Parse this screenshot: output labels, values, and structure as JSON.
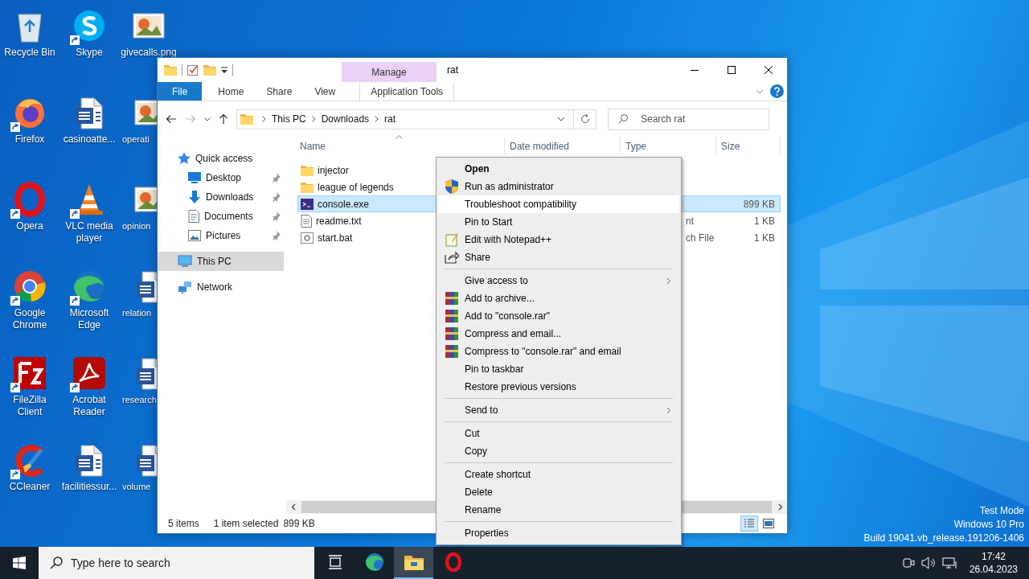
{
  "desktop": {
    "columns": [
      [
        {
          "label": "Recycle Bin",
          "kind": "recycle",
          "shortcut": false
        },
        {
          "label": "Firefox",
          "kind": "firefox",
          "shortcut": true
        },
        {
          "label": "Opera",
          "kind": "opera",
          "shortcut": true
        },
        {
          "label": "Google Chrome",
          "kind": "chrome",
          "shortcut": true
        },
        {
          "label": "FileZilla Client",
          "kind": "filezilla",
          "shortcut": true
        },
        {
          "label": "CCleaner",
          "kind": "ccleaner",
          "shortcut": true
        }
      ],
      [
        {
          "label": "Skype",
          "kind": "skype",
          "shortcut": true
        },
        {
          "label": "casinoatte...",
          "kind": "word",
          "shortcut": false
        },
        {
          "label": "VLC media player",
          "kind": "vlc",
          "shortcut": true
        },
        {
          "label": "Microsoft Edge",
          "kind": "edge",
          "shortcut": true
        },
        {
          "label": "Acrobat Reader",
          "kind": "acrobat",
          "shortcut": true
        },
        {
          "label": "facilitiessur...",
          "kind": "word",
          "shortcut": false
        }
      ],
      [
        {
          "label": "givecalls.png",
          "kind": "image",
          "shortcut": false
        },
        {
          "label": "operati",
          "kind": "image",
          "shortcut": false
        },
        {
          "label": "opinion",
          "kind": "image",
          "shortcut": false
        },
        {
          "label": "relation",
          "kind": "word",
          "shortcut": false
        },
        {
          "label": "research",
          "kind": "word",
          "shortcut": false
        },
        {
          "label": "volume",
          "kind": "word",
          "shortcut": false
        }
      ]
    ],
    "notice": [
      "Test Mode",
      "Windows 10 Pro",
      "Build 19041.vb_release.191206-1406"
    ]
  },
  "explorer": {
    "title": "rat",
    "context_group": "Manage",
    "ribbon_tabs": [
      {
        "label": "File",
        "kind": "file"
      },
      {
        "label": "Home",
        "kind": "normal"
      },
      {
        "label": "Share",
        "kind": "normal"
      },
      {
        "label": "View",
        "kind": "normal"
      },
      {
        "label": "Application Tools",
        "kind": "contextual"
      }
    ],
    "breadcrumb": [
      "This PC",
      "Downloads",
      "rat"
    ],
    "search": {
      "placeholder": "Search rat"
    },
    "nav": [
      {
        "label": "Quick access",
        "kind": "star",
        "selected": false,
        "children": [
          {
            "label": "Desktop",
            "kind": "desktop",
            "pinned": true,
            "selected": false
          },
          {
            "label": "Downloads",
            "kind": "download",
            "pinned": true,
            "selected": false
          },
          {
            "label": "Documents",
            "kind": "documents",
            "pinned": true,
            "selected": false
          },
          {
            "label": "Pictures",
            "kind": "pictures",
            "pinned": true,
            "selected": false
          }
        ]
      },
      {
        "label": "This PC",
        "kind": "pc",
        "selected": true
      },
      {
        "label": "Network",
        "kind": "network",
        "selected": false
      }
    ],
    "columns": [
      {
        "label": "Name",
        "sorted": true
      },
      {
        "label": "Date modified",
        "sorted": false
      },
      {
        "label": "Type",
        "sorted": false
      },
      {
        "label": "Size",
        "sorted": false
      }
    ],
    "files": [
      {
        "name": "injector",
        "kind": "folder",
        "selected": false
      },
      {
        "name": "league of legends",
        "kind": "folder",
        "selected": false
      },
      {
        "name": "console.exe",
        "kind": "exe",
        "size": "899 KB",
        "selected": true
      },
      {
        "name": "readme.txt",
        "kind": "txt",
        "type": "nt",
        "size": "1 KB",
        "selected": false
      },
      {
        "name": "start.bat",
        "kind": "bat",
        "type": "ch File",
        "size": "1 KB",
        "selected": false
      }
    ],
    "status": {
      "count": "5 items",
      "selection": "1 item selected",
      "size": "899 KB"
    }
  },
  "context_menu": {
    "groups": [
      [
        {
          "label": "Open",
          "bold": true,
          "kind": "plain",
          "submenu": false,
          "highlighted": false
        },
        {
          "label": "Run as administrator",
          "bold": false,
          "kind": "shield",
          "submenu": false,
          "highlighted": false
        },
        {
          "label": "Troubleshoot compatibility",
          "bold": false,
          "kind": "plain",
          "submenu": false,
          "highlighted": true
        },
        {
          "label": "Pin to Start",
          "bold": false,
          "kind": "plain",
          "submenu": false,
          "highlighted": false
        },
        {
          "label": "Edit with Notepad++",
          "bold": false,
          "kind": "notepad",
          "submenu": false,
          "highlighted": false
        },
        {
          "label": "Share",
          "bold": false,
          "kind": "share",
          "submenu": false,
          "highlighted": false
        }
      ],
      [
        {
          "label": "Give access to",
          "bold": false,
          "kind": "plain",
          "submenu": true,
          "highlighted": false
        },
        {
          "label": "Add to archive...",
          "bold": false,
          "kind": "archive",
          "submenu": false,
          "highlighted": false
        },
        {
          "label": "Add to \"console.rar\"",
          "bold": false,
          "kind": "archive",
          "submenu": false,
          "highlighted": false
        },
        {
          "label": "Compress and email...",
          "bold": false,
          "kind": "archive",
          "submenu": false,
          "highlighted": false
        },
        {
          "label": "Compress to \"console.rar\" and email",
          "bold": false,
          "kind": "archive",
          "submenu": false,
          "highlighted": false
        },
        {
          "label": "Pin to taskbar",
          "bold": false,
          "kind": "plain",
          "submenu": false,
          "highlighted": false
        },
        {
          "label": "Restore previous versions",
          "bold": false,
          "kind": "plain",
          "submenu": false,
          "highlighted": false
        }
      ],
      [
        {
          "label": "Send to",
          "bold": false,
          "kind": "plain",
          "submenu": true,
          "highlighted": false
        }
      ],
      [
        {
          "label": "Cut",
          "bold": false,
          "kind": "plain",
          "submenu": false,
          "highlighted": false
        },
        {
          "label": "Copy",
          "bold": false,
          "kind": "plain",
          "submenu": false,
          "highlighted": false
        }
      ],
      [
        {
          "label": "Create shortcut",
          "bold": false,
          "kind": "plain",
          "submenu": false,
          "highlighted": false
        },
        {
          "label": "Delete",
          "bold": false,
          "kind": "plain",
          "submenu": false,
          "highlighted": false
        },
        {
          "label": "Rename",
          "bold": false,
          "kind": "plain",
          "submenu": false,
          "highlighted": false
        }
      ],
      [
        {
          "label": "Properties",
          "bold": false,
          "kind": "plain",
          "submenu": false,
          "highlighted": false
        }
      ]
    ]
  },
  "taskbar": {
    "search": {
      "placeholder": "Type here to search"
    },
    "apps": [
      {
        "kind": "taskview",
        "active": false
      },
      {
        "kind": "edge",
        "active": false
      },
      {
        "kind": "explorer",
        "active": true
      },
      {
        "kind": "opera",
        "active": false
      }
    ],
    "time": "17:42",
    "date": "26.04.2023"
  }
}
